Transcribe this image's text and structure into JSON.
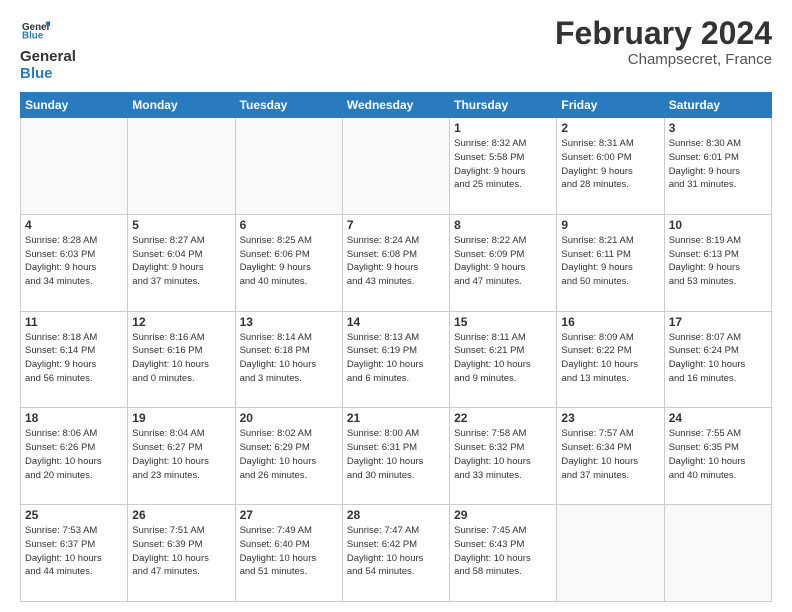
{
  "logo": {
    "general": "General",
    "blue": "Blue"
  },
  "title": "February 2024",
  "location": "Champsecret, France",
  "days_header": [
    "Sunday",
    "Monday",
    "Tuesday",
    "Wednesday",
    "Thursday",
    "Friday",
    "Saturday"
  ],
  "weeks": [
    [
      {
        "day": "",
        "info": ""
      },
      {
        "day": "",
        "info": ""
      },
      {
        "day": "",
        "info": ""
      },
      {
        "day": "",
        "info": ""
      },
      {
        "day": "1",
        "info": "Sunrise: 8:32 AM\nSunset: 5:58 PM\nDaylight: 9 hours\nand 25 minutes."
      },
      {
        "day": "2",
        "info": "Sunrise: 8:31 AM\nSunset: 6:00 PM\nDaylight: 9 hours\nand 28 minutes."
      },
      {
        "day": "3",
        "info": "Sunrise: 8:30 AM\nSunset: 6:01 PM\nDaylight: 9 hours\nand 31 minutes."
      }
    ],
    [
      {
        "day": "4",
        "info": "Sunrise: 8:28 AM\nSunset: 6:03 PM\nDaylight: 9 hours\nand 34 minutes."
      },
      {
        "day": "5",
        "info": "Sunrise: 8:27 AM\nSunset: 6:04 PM\nDaylight: 9 hours\nand 37 minutes."
      },
      {
        "day": "6",
        "info": "Sunrise: 8:25 AM\nSunset: 6:06 PM\nDaylight: 9 hours\nand 40 minutes."
      },
      {
        "day": "7",
        "info": "Sunrise: 8:24 AM\nSunset: 6:08 PM\nDaylight: 9 hours\nand 43 minutes."
      },
      {
        "day": "8",
        "info": "Sunrise: 8:22 AM\nSunset: 6:09 PM\nDaylight: 9 hours\nand 47 minutes."
      },
      {
        "day": "9",
        "info": "Sunrise: 8:21 AM\nSunset: 6:11 PM\nDaylight: 9 hours\nand 50 minutes."
      },
      {
        "day": "10",
        "info": "Sunrise: 8:19 AM\nSunset: 6:13 PM\nDaylight: 9 hours\nand 53 minutes."
      }
    ],
    [
      {
        "day": "11",
        "info": "Sunrise: 8:18 AM\nSunset: 6:14 PM\nDaylight: 9 hours\nand 56 minutes."
      },
      {
        "day": "12",
        "info": "Sunrise: 8:16 AM\nSunset: 6:16 PM\nDaylight: 10 hours\nand 0 minutes."
      },
      {
        "day": "13",
        "info": "Sunrise: 8:14 AM\nSunset: 6:18 PM\nDaylight: 10 hours\nand 3 minutes."
      },
      {
        "day": "14",
        "info": "Sunrise: 8:13 AM\nSunset: 6:19 PM\nDaylight: 10 hours\nand 6 minutes."
      },
      {
        "day": "15",
        "info": "Sunrise: 8:11 AM\nSunset: 6:21 PM\nDaylight: 10 hours\nand 9 minutes."
      },
      {
        "day": "16",
        "info": "Sunrise: 8:09 AM\nSunset: 6:22 PM\nDaylight: 10 hours\nand 13 minutes."
      },
      {
        "day": "17",
        "info": "Sunrise: 8:07 AM\nSunset: 6:24 PM\nDaylight: 10 hours\nand 16 minutes."
      }
    ],
    [
      {
        "day": "18",
        "info": "Sunrise: 8:06 AM\nSunset: 6:26 PM\nDaylight: 10 hours\nand 20 minutes."
      },
      {
        "day": "19",
        "info": "Sunrise: 8:04 AM\nSunset: 6:27 PM\nDaylight: 10 hours\nand 23 minutes."
      },
      {
        "day": "20",
        "info": "Sunrise: 8:02 AM\nSunset: 6:29 PM\nDaylight: 10 hours\nand 26 minutes."
      },
      {
        "day": "21",
        "info": "Sunrise: 8:00 AM\nSunset: 6:31 PM\nDaylight: 10 hours\nand 30 minutes."
      },
      {
        "day": "22",
        "info": "Sunrise: 7:58 AM\nSunset: 6:32 PM\nDaylight: 10 hours\nand 33 minutes."
      },
      {
        "day": "23",
        "info": "Sunrise: 7:57 AM\nSunset: 6:34 PM\nDaylight: 10 hours\nand 37 minutes."
      },
      {
        "day": "24",
        "info": "Sunrise: 7:55 AM\nSunset: 6:35 PM\nDaylight: 10 hours\nand 40 minutes."
      }
    ],
    [
      {
        "day": "25",
        "info": "Sunrise: 7:53 AM\nSunset: 6:37 PM\nDaylight: 10 hours\nand 44 minutes."
      },
      {
        "day": "26",
        "info": "Sunrise: 7:51 AM\nSunset: 6:39 PM\nDaylight: 10 hours\nand 47 minutes."
      },
      {
        "day": "27",
        "info": "Sunrise: 7:49 AM\nSunset: 6:40 PM\nDaylight: 10 hours\nand 51 minutes."
      },
      {
        "day": "28",
        "info": "Sunrise: 7:47 AM\nSunset: 6:42 PM\nDaylight: 10 hours\nand 54 minutes."
      },
      {
        "day": "29",
        "info": "Sunrise: 7:45 AM\nSunset: 6:43 PM\nDaylight: 10 hours\nand 58 minutes."
      },
      {
        "day": "",
        "info": ""
      },
      {
        "day": "",
        "info": ""
      }
    ]
  ]
}
